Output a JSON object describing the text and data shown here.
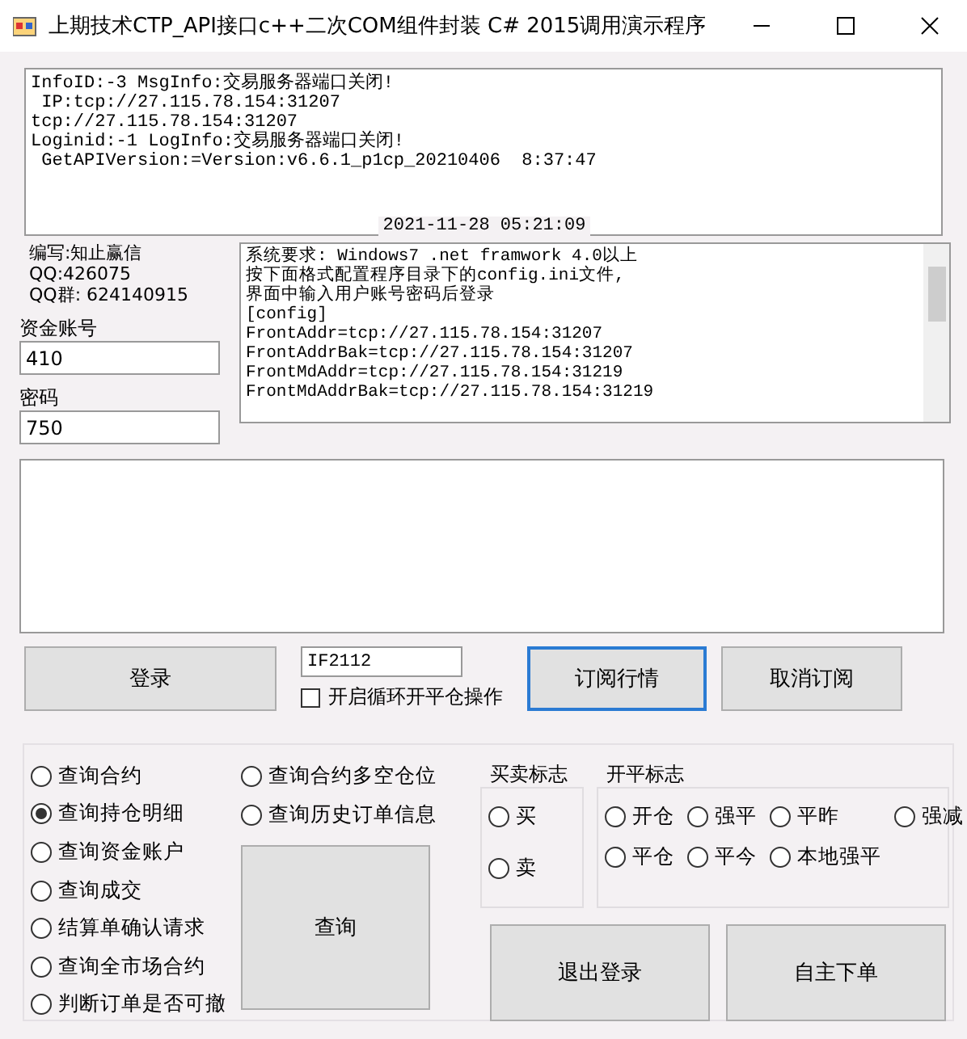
{
  "window": {
    "title": "上期技术CTP_API接口c++二次COM组件封装 C# 2015调用演示程序"
  },
  "log": {
    "lines": [
      "InfoID:-3 MsgInfo:交易服务器端口关闭!",
      " IP:tcp://27.115.78.154:31207",
      "tcp://27.115.78.154:31207",
      "Loginid:-1 LogInfo:交易服务器端口关闭!",
      " GetAPIVersion:=Version:v6.6.1_p1cp_20210406  8:37:47"
    ],
    "timestamp": "2021-11-28 05:21:09"
  },
  "info": {
    "author": "编写:知止赢信",
    "qq": "QQ:426075",
    "qq_group": "QQ群: 624140915"
  },
  "account": {
    "label": "资金账号",
    "value": "410"
  },
  "password": {
    "label": "密码",
    "value": "750"
  },
  "config_text": {
    "lines": [
      "系统要求: Windows7 .net framwork 4.0以上",
      "按下面格式配置程序目录下的config.ini文件,",
      "界面中输入用户账号密码后登录",
      "[config]",
      "FrontAddr=tcp://27.115.78.154:31207",
      "FrontAddrBak=tcp://27.115.78.154:31207",
      "FrontMdAddr=tcp://27.115.78.154:31219",
      "FrontMdAddrBak=tcp://27.115.78.154:31219"
    ]
  },
  "login_button": {
    "label": "登录"
  },
  "instrument_field": {
    "value": "IF2112"
  },
  "loop_checkbox": {
    "label": "开启循环开平仓操作",
    "checked": false
  },
  "subscribe_button": {
    "label": "订阅行情",
    "focused": true
  },
  "unsubscribe_button": {
    "label": "取消订阅",
    "focused": false
  },
  "query_options": [
    {
      "label": "查询合约",
      "selected": false
    },
    {
      "label": "查询持仓明细",
      "selected": true
    },
    {
      "label": "查询资金账户",
      "selected": false
    },
    {
      "label": "查询成交",
      "selected": false
    },
    {
      "label": "结算单确认请求",
      "selected": false
    },
    {
      "label": "查询全市场合约",
      "selected": false
    },
    {
      "label": "判断订单是否可撤",
      "selected": false
    }
  ],
  "query_options_2": [
    {
      "label": "查询合约多空仓位",
      "selected": false
    },
    {
      "label": "查询历史订单信息",
      "selected": false
    }
  ],
  "query_button": {
    "label": "查询"
  },
  "direction_group": {
    "title": "买卖标志",
    "options": [
      {
        "label": "买",
        "selected": false
      },
      {
        "label": "卖",
        "selected": false
      }
    ]
  },
  "offset_group": {
    "title": "开平标志",
    "options": [
      {
        "label": "开仓",
        "selected": false
      },
      {
        "label": "强平",
        "selected": false
      },
      {
        "label": "平昨",
        "selected": false
      },
      {
        "label": "强减",
        "selected": false
      },
      {
        "label": "平仓",
        "selected": false
      },
      {
        "label": "平今",
        "selected": false
      },
      {
        "label": "本地强平",
        "selected": false
      }
    ]
  },
  "logout_button": {
    "label": "退出登录"
  },
  "order_button": {
    "label": "自主下单"
  }
}
